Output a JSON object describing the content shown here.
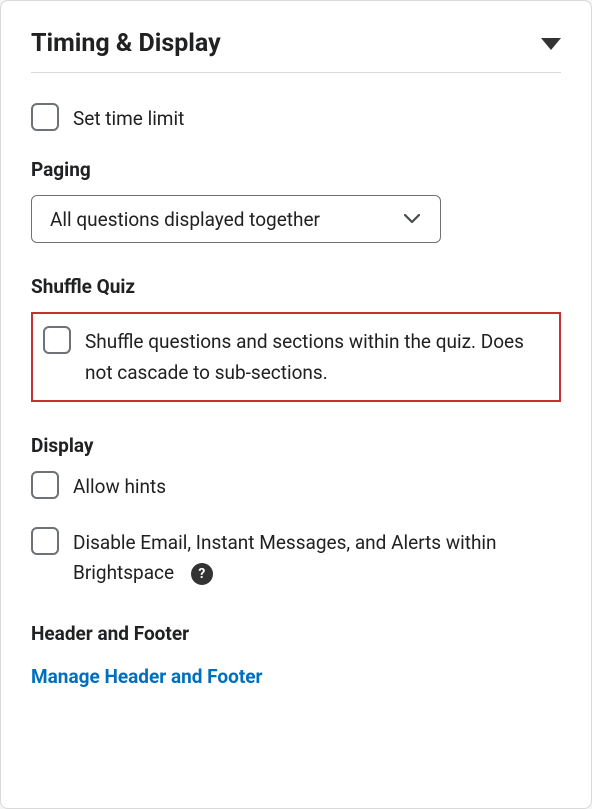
{
  "panel": {
    "title": "Timing & Display"
  },
  "timeLimit": {
    "label": "Set time limit"
  },
  "paging": {
    "heading": "Paging",
    "selected": "All questions displayed together"
  },
  "shuffle": {
    "heading": "Shuffle Quiz",
    "label": "Shuffle questions and sections within the quiz. Does not cascade to sub-sections."
  },
  "display": {
    "heading": "Display",
    "allowHints": "Allow hints",
    "disableComms": "Disable Email, Instant Messages, and Alerts within Brightspace"
  },
  "headerFooter": {
    "heading": "Header and Footer",
    "manageLink": "Manage Header and Footer"
  }
}
